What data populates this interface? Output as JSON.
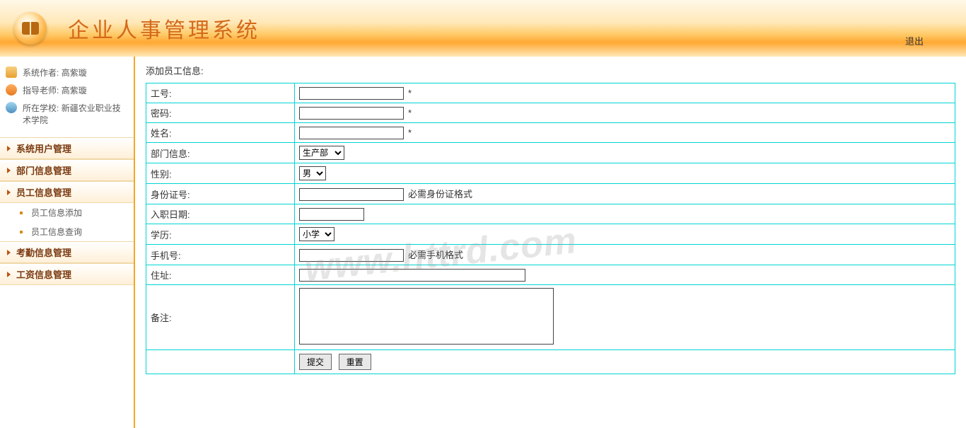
{
  "header": {
    "title": "企业人事管理系统",
    "logout": "退出"
  },
  "sidebar": {
    "info": [
      {
        "label": "系统作者:",
        "value": "高紫璇"
      },
      {
        "label": "指导老师:",
        "value": "高紫璇"
      },
      {
        "label": "所在学校:",
        "value": "新疆农业职业技术学院"
      }
    ],
    "menu": [
      {
        "label": "系统用户管理",
        "type": "cat"
      },
      {
        "label": "部门信息管理",
        "type": "cat"
      },
      {
        "label": "员工信息管理",
        "type": "cat"
      },
      {
        "label": "员工信息添加",
        "type": "sub"
      },
      {
        "label": "员工信息查询",
        "type": "sub"
      },
      {
        "label": "考勤信息管理",
        "type": "cat"
      },
      {
        "label": "工资信息管理",
        "type": "cat"
      }
    ]
  },
  "form": {
    "title": "添加员工信息:",
    "fields": {
      "emp_id": {
        "label": "工号:",
        "hint": "*"
      },
      "password": {
        "label": "密码:",
        "hint": "*"
      },
      "name": {
        "label": "姓名:",
        "hint": "*"
      },
      "dept": {
        "label": "部门信息:",
        "selected": "生产部"
      },
      "gender": {
        "label": "性别:",
        "selected": "男"
      },
      "idcard": {
        "label": "身份证号:",
        "hint": "必需身份证格式"
      },
      "hiredate": {
        "label": "入职日期:"
      },
      "edu": {
        "label": "学历:",
        "selected": "小学"
      },
      "phone": {
        "label": "手机号:",
        "hint": "必需手机格式"
      },
      "address": {
        "label": "住址:"
      },
      "remark": {
        "label": "备注:"
      }
    },
    "buttons": {
      "submit": "提交",
      "reset": "重置"
    }
  },
  "watermark": "www.httrd.com"
}
